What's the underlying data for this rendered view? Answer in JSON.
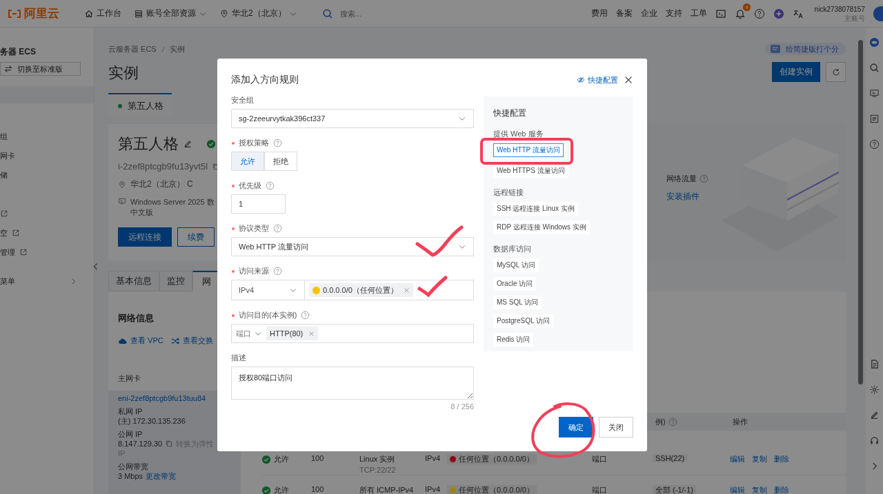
{
  "topbar": {
    "logo": "阿里云",
    "nav": [
      {
        "kind": "home",
        "label": "工作台"
      },
      {
        "kind": "resources",
        "label": "账号全部资源"
      },
      {
        "kind": "region",
        "label": "华北2（北京）"
      }
    ],
    "search": {
      "placeholder": "搜索..."
    },
    "links": [
      "费用",
      "备案",
      "企业",
      "支持",
      "工单"
    ],
    "notification_count": "4",
    "user": {
      "name": "nick2738078157",
      "role": "主账号"
    }
  },
  "sidebar": {
    "title": "务器 ECS",
    "switch_button": "切换至标准版",
    "items": [
      {
        "kind": "plain",
        "label": "组"
      },
      {
        "kind": "plain",
        "label": "网卡"
      },
      {
        "kind": "plain",
        "label": "储"
      },
      {
        "kind": "icon-only"
      },
      {
        "kind": "external",
        "label": "空"
      },
      {
        "kind": "external",
        "label": "管理"
      },
      {
        "kind": "submenu",
        "label": "菜单"
      }
    ]
  },
  "breadcrumb": [
    "云服务器 ECS",
    "实例"
  ],
  "page_title": "实例",
  "rating_badge": "给简捷版打个分",
  "create_button": "创建实例",
  "instance_tab": {
    "label": "第五人格"
  },
  "instance": {
    "name": "第五人格",
    "id": "i-2zef8ptcgb9fu13yvt5l",
    "zone": "华北2（北京） C",
    "os_lines": [
      "Windows Server 2025 数",
      "中文版"
    ],
    "buttons": [
      {
        "label": "远程连接",
        "primary": true
      },
      {
        "label": "续费",
        "primary": false
      }
    ]
  },
  "traffic": {
    "label": "网络流量",
    "link": "安装插件"
  },
  "detail_tabs": [
    {
      "label": "基本信息",
      "selected": false
    },
    {
      "label": "监控",
      "selected": false
    },
    {
      "label": "网",
      "selected": true
    }
  ],
  "network": {
    "title": "网络信息",
    "links": [
      {
        "kind": "vpc",
        "label": "查看 VPC"
      },
      {
        "kind": "switch",
        "label": "查看交换"
      }
    ],
    "nic_title": "主网卡",
    "nic_id": "eni-2zef8ptcgb9fu13tuu84",
    "private_ip_label": "私网 IP",
    "private_ip": "(主) 172.30.135.236",
    "public_ip_label": "公网 IP",
    "public_ip": "8.147.129.30",
    "convert_link": "转换为弹性",
    "convert_link_rest": "IP",
    "bandwidth_label": "公网带宽",
    "bandwidth": "3 Mbps",
    "bandwidth_link": "更改带宽"
  },
  "rules_table": {
    "columns": [
      {
        "label": "例)",
        "help": true
      },
      {
        "label": "操作",
        "help": false
      }
    ],
    "rows": [
      {
        "policy": "允许",
        "priority": "100",
        "protocol": "Linux 实例",
        "port_range": "TCP:22/22",
        "ip_version": "IPv4",
        "source": "任何位置（0.0.0.0/0）",
        "color": "#8a0a14",
        "dest_kind": "端口",
        "dest": "SSH(22)",
        "actions": [
          "编辑",
          "复制",
          "删除"
        ]
      },
      {
        "policy": "允许",
        "priority": "100",
        "protocol": "所有 ICMP-IPv4",
        "ip_version": "IPv4",
        "source": "任何位置（0.0.0.0/0）",
        "color": "#9a8410",
        "dest_kind": "端口",
        "dest": "全部 (-1/-1)",
        "actions": [
          "编辑",
          "复制",
          "删除"
        ]
      }
    ]
  },
  "dialog": {
    "title": "添加入方向规则",
    "quick_toggle": "快捷配置",
    "fields": [
      {
        "kind": "select",
        "label": "安全组",
        "required": false,
        "help": false,
        "value": "sg-2zeeurvytkak396ct337"
      },
      {
        "kind": "segmented",
        "label": "授权策略",
        "required": true,
        "help": true,
        "options": [
          {
            "label": "允许",
            "selected": true
          },
          {
            "label": "拒绝",
            "selected": false
          }
        ]
      },
      {
        "kind": "input",
        "label": "优先级",
        "required": true,
        "help": true,
        "value": "1"
      },
      {
        "kind": "select",
        "label": "协议类型",
        "required": true,
        "help": true,
        "value": "Web HTTP 流量访问"
      },
      {
        "kind": "source",
        "label": "访问来源",
        "required": true,
        "help": true,
        "value": "IPv4",
        "tags": [
          {
            "label": "0.0.0.0/0（任何位置）",
            "color": "#f5c400"
          }
        ]
      },
      {
        "kind": "destination",
        "label": "访问目的(本实例)",
        "required": true,
        "help": true,
        "value": "端口",
        "tags": [
          {
            "label": "HTTP(80)"
          }
        ]
      },
      {
        "kind": "textarea",
        "label": "描述",
        "required": false,
        "help": false,
        "value": "授权80端口访问",
        "counter": "8 / 256"
      }
    ],
    "quick_panel": {
      "title": "快捷配置",
      "groups": [
        {
          "title": "提供 Web 服务",
          "items": [
            {
              "label": "Web HTTP 流量访问",
              "selected": true
            },
            {
              "label": "Web HTTPS 流量访问",
              "selected": false
            }
          ]
        },
        {
          "title": "远程链接",
          "items": [
            {
              "label": "SSH 远程连接 Linux 实例",
              "selected": false
            },
            {
              "label": "RDP 远程连接 Windows 实例",
              "selected": false
            }
          ]
        },
        {
          "title": "数据库访问",
          "items": [
            {
              "label": "MySQL 访问",
              "selected": false
            },
            {
              "label": "Oracle 访问",
              "selected": false
            },
            {
              "label": "MS SQL 访问",
              "selected": false
            },
            {
              "label": "PostgreSQL 访问",
              "selected": false
            },
            {
              "label": "Redis 访问",
              "selected": false
            }
          ]
        }
      ]
    },
    "buttons": [
      {
        "label": "确定",
        "primary": true
      },
      {
        "label": "关闭",
        "primary": false
      }
    ]
  }
}
